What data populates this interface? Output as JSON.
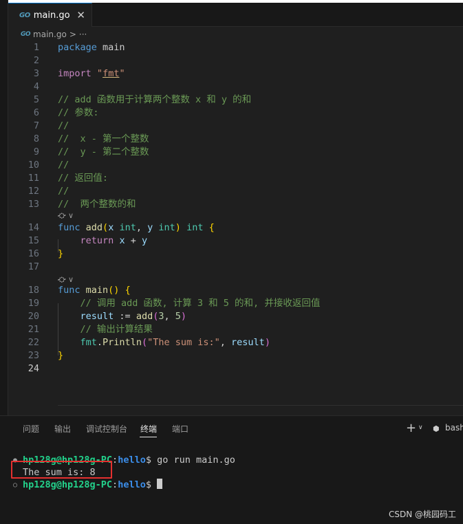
{
  "editor": {
    "tab": {
      "icon": "go-file-icon",
      "icon_text": "GO",
      "label": "main.go",
      "close_icon": "close-icon",
      "close_text": "✕"
    },
    "breadcrumb": {
      "file": "main.go",
      "separator": ">",
      "more": "···"
    },
    "lines": [
      {
        "n": "1",
        "tokens": [
          [
            "kw",
            "package"
          ],
          [
            "op",
            " "
          ],
          [
            "plain",
            "main"
          ]
        ]
      },
      {
        "n": "2",
        "tokens": []
      },
      {
        "n": "3",
        "tokens": [
          [
            "kw2",
            "import"
          ],
          [
            "op",
            " "
          ],
          [
            "str",
            "\""
          ],
          [
            "strU",
            "fmt"
          ],
          [
            "str",
            "\""
          ]
        ]
      },
      {
        "n": "4",
        "tokens": []
      },
      {
        "n": "5",
        "tokens": [
          [
            "cm",
            "// add 函数用于计算两个整数 x 和 y 的和"
          ]
        ]
      },
      {
        "n": "6",
        "tokens": [
          [
            "cm",
            "// 参数:"
          ]
        ]
      },
      {
        "n": "7",
        "tokens": [
          [
            "cm",
            "//"
          ]
        ]
      },
      {
        "n": "8",
        "tokens": [
          [
            "cm",
            "//  x - 第一个整数"
          ]
        ]
      },
      {
        "n": "9",
        "tokens": [
          [
            "cm",
            "//  y - 第二个整数"
          ]
        ]
      },
      {
        "n": "10",
        "tokens": [
          [
            "cm",
            "//"
          ]
        ]
      },
      {
        "n": "11",
        "tokens": [
          [
            "cm",
            "// 返回值:"
          ]
        ]
      },
      {
        "n": "12",
        "tokens": [
          [
            "cm",
            "//"
          ]
        ]
      },
      {
        "n": "13",
        "tokens": [
          [
            "cm",
            "//  两个整数的和"
          ]
        ]
      },
      {
        "n": "14",
        "tokens": [
          [
            "kw",
            "func"
          ],
          [
            "op",
            " "
          ],
          [
            "fn",
            "add"
          ],
          [
            "br1",
            "("
          ],
          [
            "id",
            "x"
          ],
          [
            "op",
            " "
          ],
          [
            "ty",
            "int"
          ],
          [
            "op",
            ", "
          ],
          [
            "id",
            "y"
          ],
          [
            "op",
            " "
          ],
          [
            "ty",
            "int"
          ],
          [
            "br1",
            ")"
          ],
          [
            "op",
            " "
          ],
          [
            "ty",
            "int"
          ],
          [
            "op",
            " "
          ],
          [
            "br1",
            "{"
          ]
        ]
      },
      {
        "n": "15",
        "tokens": [
          [
            "op",
            "    "
          ],
          [
            "kw2",
            "return"
          ],
          [
            "op",
            " "
          ],
          [
            "id",
            "x"
          ],
          [
            "op",
            " + "
          ],
          [
            "id",
            "y"
          ]
        ]
      },
      {
        "n": "16",
        "tokens": [
          [
            "br1",
            "}"
          ]
        ]
      },
      {
        "n": "17",
        "tokens": []
      },
      {
        "n": "18",
        "tokens": [
          [
            "kw",
            "func"
          ],
          [
            "op",
            " "
          ],
          [
            "fn",
            "main"
          ],
          [
            "br1",
            "()"
          ],
          [
            "op",
            " "
          ],
          [
            "br1",
            "{"
          ]
        ]
      },
      {
        "n": "19",
        "tokens": [
          [
            "op",
            "    "
          ],
          [
            "cm",
            "// 调用 add 函数, 计算 3 和 5 的和, 并接收返回值"
          ]
        ]
      },
      {
        "n": "20",
        "tokens": [
          [
            "op",
            "    "
          ],
          [
            "id",
            "result"
          ],
          [
            "op",
            " := "
          ],
          [
            "fn",
            "add"
          ],
          [
            "br2",
            "("
          ],
          [
            "num",
            "3"
          ],
          [
            "op",
            ", "
          ],
          [
            "num",
            "5"
          ],
          [
            "br2",
            ")"
          ]
        ]
      },
      {
        "n": "21",
        "tokens": [
          [
            "op",
            "    "
          ],
          [
            "cm",
            "// 输出计算结果"
          ]
        ]
      },
      {
        "n": "22",
        "tokens": [
          [
            "op",
            "    "
          ],
          [
            "ty",
            "fmt"
          ],
          [
            "op",
            "."
          ],
          [
            "fn",
            "Println"
          ],
          [
            "br2",
            "("
          ],
          [
            "str",
            "\"The sum is:\""
          ],
          [
            "op",
            ", "
          ],
          [
            "id",
            "result"
          ],
          [
            "br2",
            ")"
          ]
        ]
      },
      {
        "n": "23",
        "tokens": [
          [
            "br1",
            "}"
          ]
        ]
      },
      {
        "n": "24",
        "tokens": []
      }
    ],
    "codelens_icon": "copilot-icon",
    "codelens_text": "⛮ ∨"
  },
  "panel": {
    "tabs": [
      "问题",
      "输出",
      "调试控制台",
      "终端",
      "端口"
    ],
    "active_tab": "终端",
    "add_icon": "plus-icon",
    "add_text": "+",
    "dropdown_text": "∨",
    "shell_icon": "terminal-shell-icon",
    "shell_label": "bash"
  },
  "terminal": {
    "prompt_user": "hp128g@hp128g-PC",
    "prompt_sep": ":",
    "prompt_path": "hello",
    "prompt_dollar": "$ ",
    "command": "go run main.go",
    "output": "The sum is: 8"
  },
  "watermark": "CSDN @桃园码工"
}
